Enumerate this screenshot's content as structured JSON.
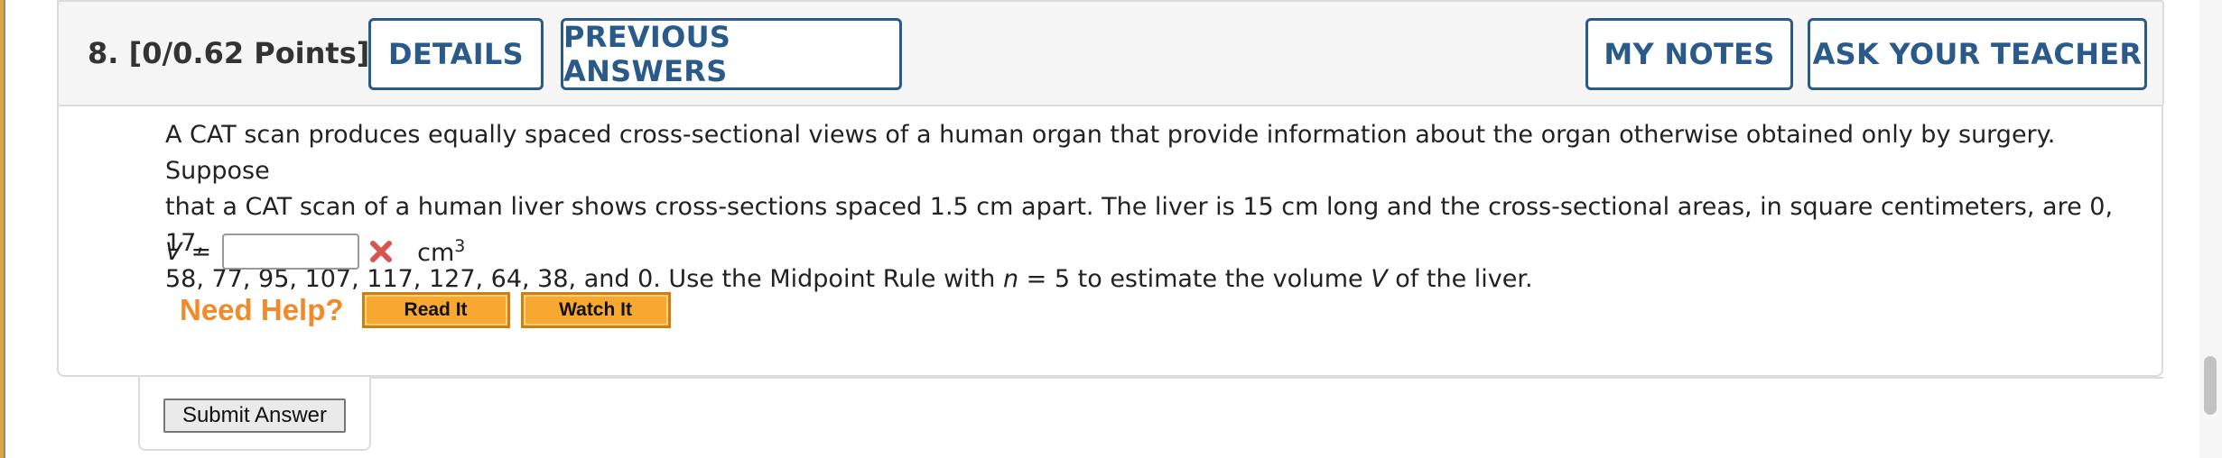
{
  "header": {
    "question_number": "8.",
    "points": "[0/0.62 Points]",
    "details_label": "DETAILS",
    "previous_answers_label": "PREVIOUS ANSWERS",
    "my_notes_label": "MY NOTES",
    "ask_teacher_label": "ASK YOUR TEACHER"
  },
  "problem": {
    "p1": "A CAT scan produces equally spaced cross-sectional views of a human organ that provide information about the organ otherwise obtained only by surgery. Suppose",
    "p2": "that a CAT scan of a human liver shows cross-sections spaced 1.5 cm apart. The liver is 15 cm long and the cross-sectional areas, in square centimeters, are 0, 17,",
    "p3_a": "58, 77, 95, 107, 117, 127, 64, 38, and 0. Use the Midpoint Rule with ",
    "p3_n": "n",
    "p3_b": " = 5 to estimate the volume ",
    "p3_v": "V",
    "p3_c": " of the liver."
  },
  "answer": {
    "variable": "V",
    "equals": "=",
    "value": "",
    "status_icon": "incorrect-x-icon",
    "unit_base": "cm",
    "unit_exp": "3"
  },
  "help": {
    "label": "Need Help?",
    "read_it": "Read It",
    "watch_it": "Watch It"
  },
  "submit": {
    "label": "Submit Answer"
  },
  "colors": {
    "accent_blue": "#2a5a8a",
    "help_orange": "#f08a2a",
    "button_orange": "#f7a830",
    "error_red": "#d9534f"
  }
}
